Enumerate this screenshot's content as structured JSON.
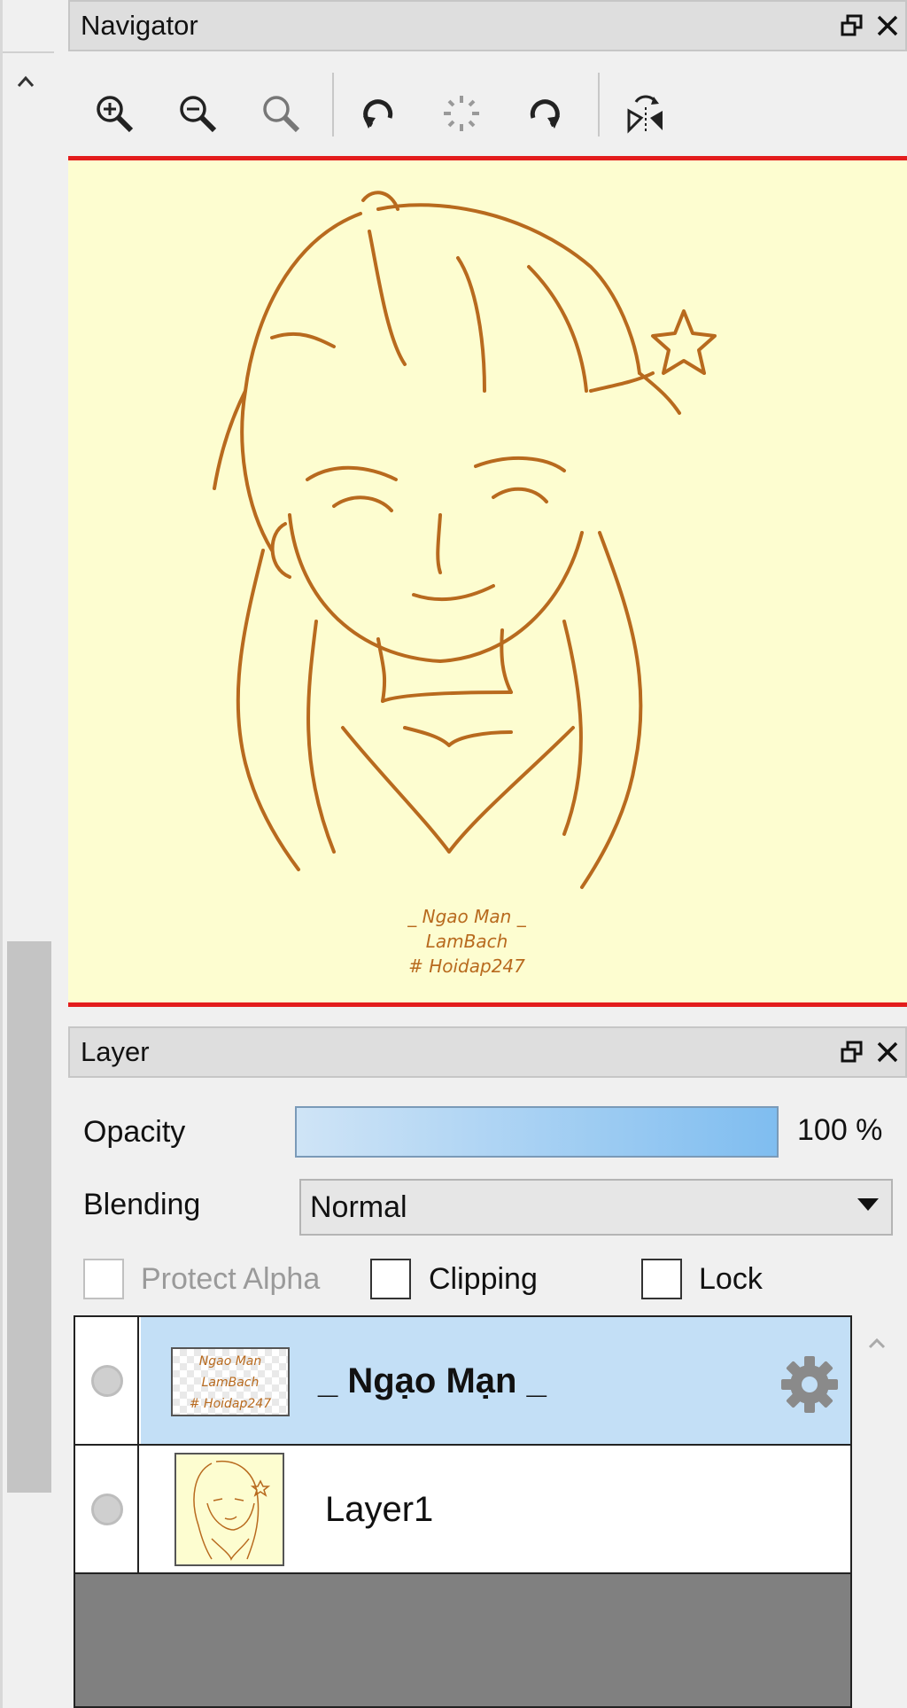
{
  "navigator": {
    "title": "Navigator",
    "toolbar": {
      "zoom_in": "zoom-in-icon",
      "zoom_out": "zoom-out-icon",
      "zoom_fit": "zoom-fit-icon",
      "rotate_left": "rotate-left-icon",
      "rotate_reset": "rotate-reset-icon",
      "rotate_right": "rotate-right-icon",
      "flip": "flip-horizontal-icon"
    },
    "preview": {
      "signature": [
        "_ Ngao Man _",
        "LamBach",
        "# Hoidap247"
      ],
      "background": "#fdfdd0",
      "ink": "#b86a1e",
      "frame": "#e31c1c"
    }
  },
  "layer_panel": {
    "title": "Layer",
    "opacity_label": "Opacity",
    "opacity_value": "100 %",
    "opacity": 1.0,
    "blending_label": "Blending",
    "blending_value": "Normal",
    "protect_alpha_label": "Protect Alpha",
    "clipping_label": "Clipping",
    "lock_label": "Lock",
    "layers": [
      {
        "name": "_ Ngạo Mạn _",
        "selected": true,
        "thumb_text": [
          "Ngao Man",
          "LamBach",
          "# Hoidap247"
        ]
      },
      {
        "name": "Layer1",
        "selected": false
      }
    ]
  },
  "colors": {
    "accent_selected": "#c3dff6",
    "opacity_bar": "#7fbdf0"
  }
}
